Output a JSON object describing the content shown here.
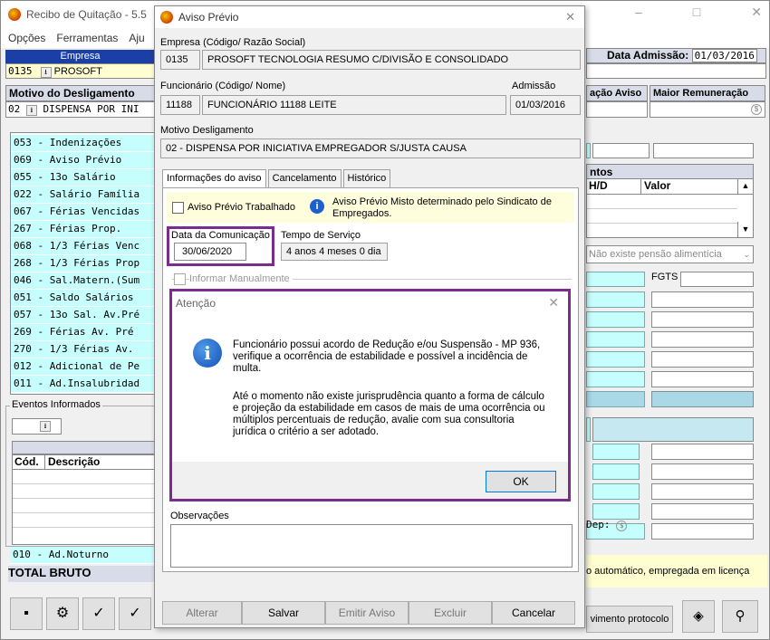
{
  "main": {
    "title": "Recibo de Quitação - 5.5",
    "menu": [
      "Opções",
      "Ferramentas",
      "Aju"
    ],
    "empresa_header": "Empresa",
    "empresa_code": "0135",
    "empresa_name": "PROSOFT",
    "data_admissao_label": "Data Admissão:",
    "data_admissao_value": "01/03/2016",
    "motivo_header": "Motivo do Desligamento",
    "motivo_value": "02",
    "motivo_text": "DISPENSA POR INI",
    "aviso_header": "ação Aviso",
    "maior_header": "Maior Remuneração",
    "verbas": [
      "053 - Indenizações",
      "069 - Aviso Prévio",
      "055 - 13o Salário",
      "022 - Salário Família",
      "067 - Férias Vencidas",
      "267 - Férias Prop.",
      "068 - 1/3 Férias Venc",
      "268 - 1/3 Férias Prop",
      "046 - Sal.Matern.(Sum",
      "051 - Saldo Salários",
      "057 - 13o Sal. Av.Pré",
      "269 - Férias Av. Pré",
      "270 - 1/3 Férias Av.",
      "012 - Adicional de Pe",
      "011 - Ad.Insalubridad"
    ],
    "eventos_label": "Eventos Informados",
    "cod_header": "Cód.",
    "desc_header": "Descrição",
    "adnoturno": "010 - Ad.Noturno",
    "total_bruto": "TOTAL BRUTO",
    "ntos_header": "ntos",
    "hd_header": "H/D",
    "valor_header": "Valor",
    "pensao": "Não existe pensão alimentícia",
    "fgts": "FGTS",
    "dep": "Dep:",
    "automatico": "o automático, empregada em licença",
    "protocolo": "vimento protocolo",
    "win_controls": [
      "–",
      "□",
      "✕"
    ]
  },
  "dialog": {
    "title": "Aviso Prévio",
    "empresa_label": "Empresa (Código/ Razão Social)",
    "empresa_code": "0135",
    "empresa_name": "PROSOFT TECNOLOGIA RESUMO C/DIVISÃO E CONSOLIDADO",
    "func_label": "Funcionário (Código/ Nome)",
    "func_code": "11188",
    "func_name": "FUNCIONÁRIO 11188 LEITE",
    "admissao_label": "Admissão",
    "admissao_value": "01/03/2016",
    "motivo_label": "Motivo Desligamento",
    "motivo_value": "02 - DISPENSA POR INICIATIVA EMPREGADOR S/JUSTA CAUSA",
    "tabs": [
      "Informações do aviso",
      "Cancelamento",
      "Histórico"
    ],
    "trabalhado_label": "Aviso Prévio Trabalhado",
    "misto_text": "Aviso Prévio Misto determinado pelo Sindicato de Empregados.",
    "data_com_label": "Data da Comunicação",
    "data_com_value": "30/06/2020",
    "tempo_label": "Tempo de Serviço",
    "tempo_value": "4 anos 4 meses 0 dia",
    "informar_label": "Informar Manualmente",
    "observacoes_label": "Observações",
    "buttons": [
      "Alterar",
      "Salvar",
      "Emitir Aviso",
      "Excluir",
      "Cancelar"
    ]
  },
  "alert": {
    "title": "Atenção",
    "p1": "Funcionário possui acordo de Redução e/ou Suspensão - MP 936, verifique a ocorrência de estabilidade e possível a incidência de multa.",
    "p2": "Até o momento não existe jurisprudência quanto a forma de cálculo e projeção da estabilidade em casos de mais de uma ocorrência ou múltiplos percentuais de redução, avalie com sua consultoria jurídica o critério a ser adotado.",
    "ok": "OK"
  },
  "colors": {
    "accent": "#7b2c8c",
    "cyan": "#c6fdfd",
    "navy": "#1a3fa6"
  }
}
